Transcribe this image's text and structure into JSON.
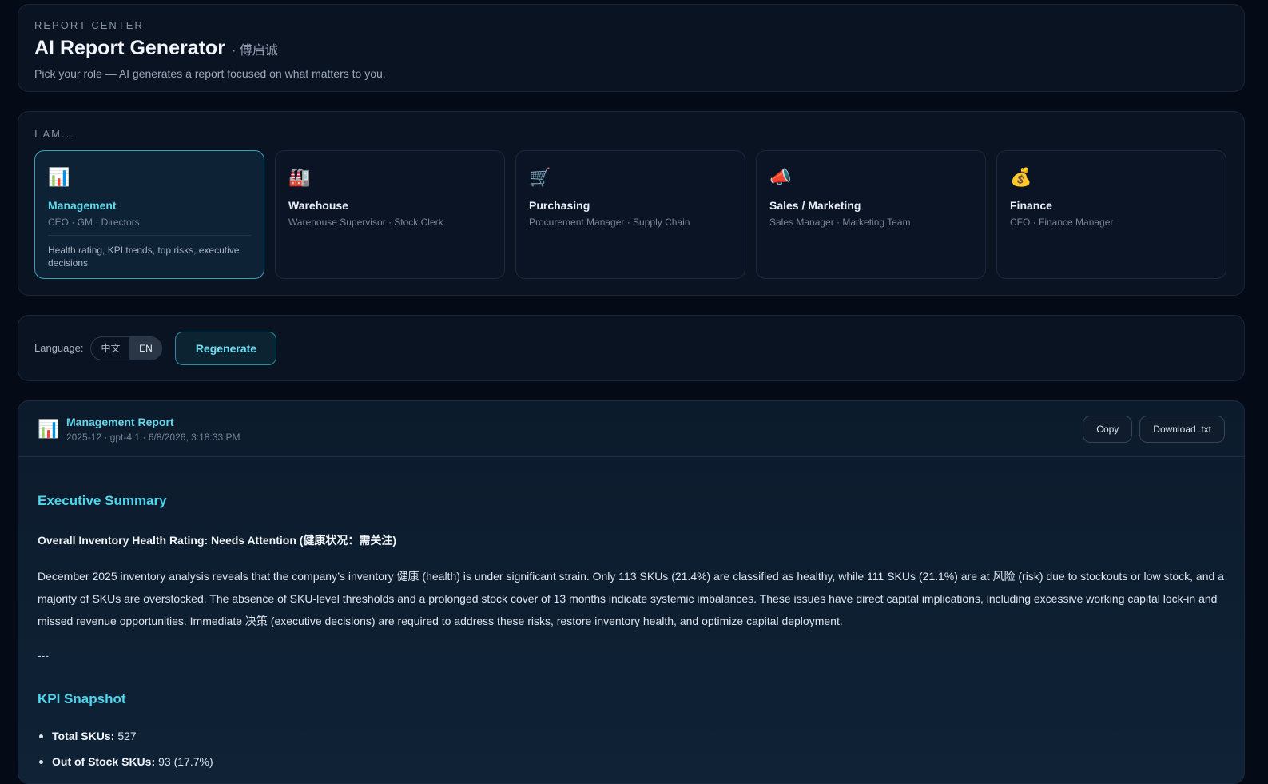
{
  "header": {
    "eyebrow": "REPORT CENTER",
    "title": "AI Report Generator",
    "title_suffix": "· 傅启诚",
    "subtitle": "Pick your role — AI generates a report focused on what matters to you."
  },
  "roles": {
    "label": "I AM...",
    "items": [
      {
        "icon": "📊",
        "icon_name": "bar-chart-icon",
        "name": "Management",
        "sub": "CEO · GM · Directors",
        "desc": "Health rating, KPI trends, top risks, executive decisions",
        "active": true
      },
      {
        "icon": "🏭",
        "icon_name": "factory-icon",
        "name": "Warehouse",
        "sub": "Warehouse Supervisor · Stock Clerk",
        "desc": "",
        "active": false
      },
      {
        "icon": "🛒",
        "icon_name": "cart-icon",
        "name": "Purchasing",
        "sub": "Procurement Manager · Supply Chain",
        "desc": "",
        "active": false
      },
      {
        "icon": "📣",
        "icon_name": "megaphone-icon",
        "name": "Sales / Marketing",
        "sub": "Sales Manager · Marketing Team",
        "desc": "",
        "active": false
      },
      {
        "icon": "💰",
        "icon_name": "money-bag-icon",
        "name": "Finance",
        "sub": "CFO · Finance Manager",
        "desc": "",
        "active": false
      }
    ]
  },
  "controls": {
    "language_label": "Language:",
    "lang_zh": "中文",
    "lang_en": "EN",
    "selected_language": "EN",
    "regenerate_label": "Regenerate"
  },
  "report": {
    "icon": "📊",
    "title": "Management Report",
    "meta": "2025-12 · gpt-4.1 · 6/8/2026, 3:18:33 PM",
    "copy_label": "Copy",
    "download_label": "Download .txt",
    "summary_title": "Executive Summary",
    "rating": "Overall Inventory Health Rating: Needs Attention (健康状况：需关注)",
    "summary_text": "December 2025 inventory analysis reveals that the company’s inventory 健康 (health) is under significant strain. Only 113 SKUs (21.4%) are classified as healthy, while 111 SKUs (21.1%) are at 风险 (risk) due to stockouts or low stock, and a majority of SKUs are overstocked. The absence of SKU-level thresholds and a prolonged stock cover of 13 months indicate systemic imbalances. These issues have direct capital implications, including excessive working capital lock-in and missed revenue opportunities. Immediate 决策 (executive decisions) are required to address these risks, restore inventory health, and optimize capital deployment.",
    "divider_text": "---",
    "kpi_title": "KPI Snapshot",
    "kpis": [
      {
        "label": "Total SKUs:",
        "value": "527"
      },
      {
        "label": "Out of Stock SKUs:",
        "value": "93 (17.7%)"
      }
    ]
  }
}
